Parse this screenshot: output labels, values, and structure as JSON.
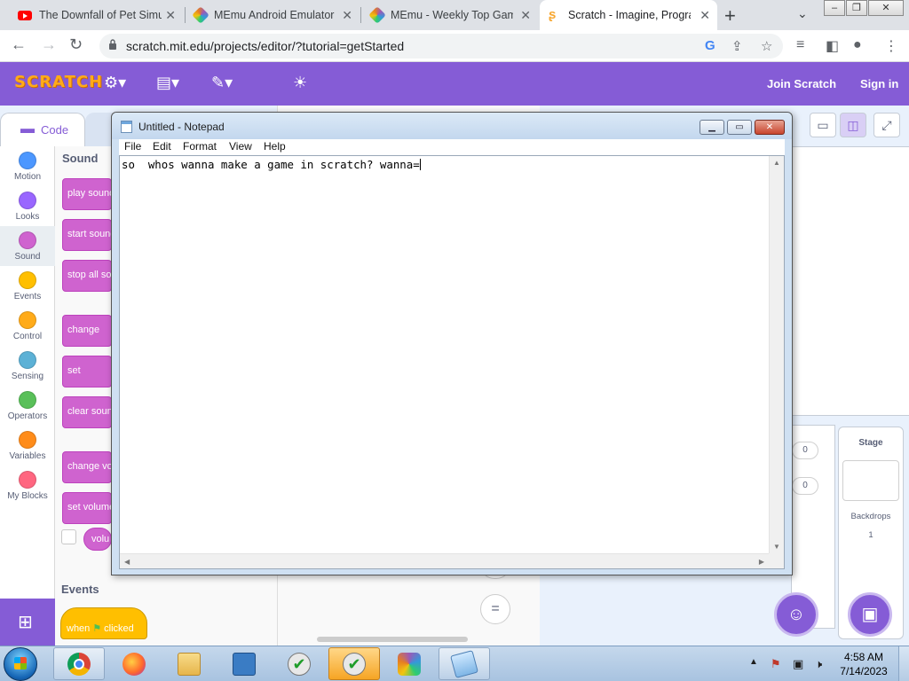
{
  "browser": {
    "tabs": [
      {
        "label": "The Downfall of Pet Simu",
        "favicon": "youtube-icon",
        "active": false
      },
      {
        "label": "MEmu Android Emulator",
        "favicon": "memu-icon",
        "active": false
      },
      {
        "label": "MEmu - Weekly Top Gam",
        "favicon": "memu-icon",
        "active": false
      },
      {
        "label": "Scratch - Imagine, Progra",
        "favicon": "scratch-icon",
        "active": true
      }
    ],
    "url": "scratch.mit.edu/projects/editor/?tutorial=getStarted"
  },
  "scratch": {
    "menu": {
      "join": "Join Scratch",
      "signin": "Sign in"
    },
    "code_tab": "Code",
    "categories": [
      {
        "label": "Motion",
        "color": "#4c97ff"
      },
      {
        "label": "Looks",
        "color": "#9966ff"
      },
      {
        "label": "Sound",
        "color": "#cf63cf"
      },
      {
        "label": "Events",
        "color": "#ffbf00"
      },
      {
        "label": "Control",
        "color": "#ffab19"
      },
      {
        "label": "Sensing",
        "color": "#5cb1d6"
      },
      {
        "label": "Operators",
        "color": "#59c059"
      },
      {
        "label": "Variables",
        "color": "#ff8c1a"
      },
      {
        "label": "My Blocks",
        "color": "#ff6680"
      }
    ],
    "palette_heading": "Sound",
    "blocks": [
      "play sound",
      "start sound",
      "stop all so",
      "change",
      "set",
      "clear soun",
      "change vo",
      "set volume",
      "volu"
    ],
    "events_heading": "Events",
    "hat_block": {
      "when": "when",
      "clicked": "clicked"
    },
    "zoom_reset": "=",
    "sprite_info": [
      "0",
      "0"
    ],
    "stage_card": {
      "title": "Stage",
      "backdrops_label": "Backdrops",
      "backdrops_count": "1"
    }
  },
  "notepad": {
    "title": "Untitled - Notepad",
    "menu": [
      "File",
      "Edit",
      "Format",
      "View",
      "Help"
    ],
    "text": "so  whos wanna make a game in scratch? wanna="
  },
  "taskbar": {
    "time": "4:58 AM",
    "date": "7/14/2023"
  },
  "colors": {
    "scratch_purple": "#855cd6",
    "sound_block": "#cf63cf",
    "events_block": "#ffbf00"
  }
}
